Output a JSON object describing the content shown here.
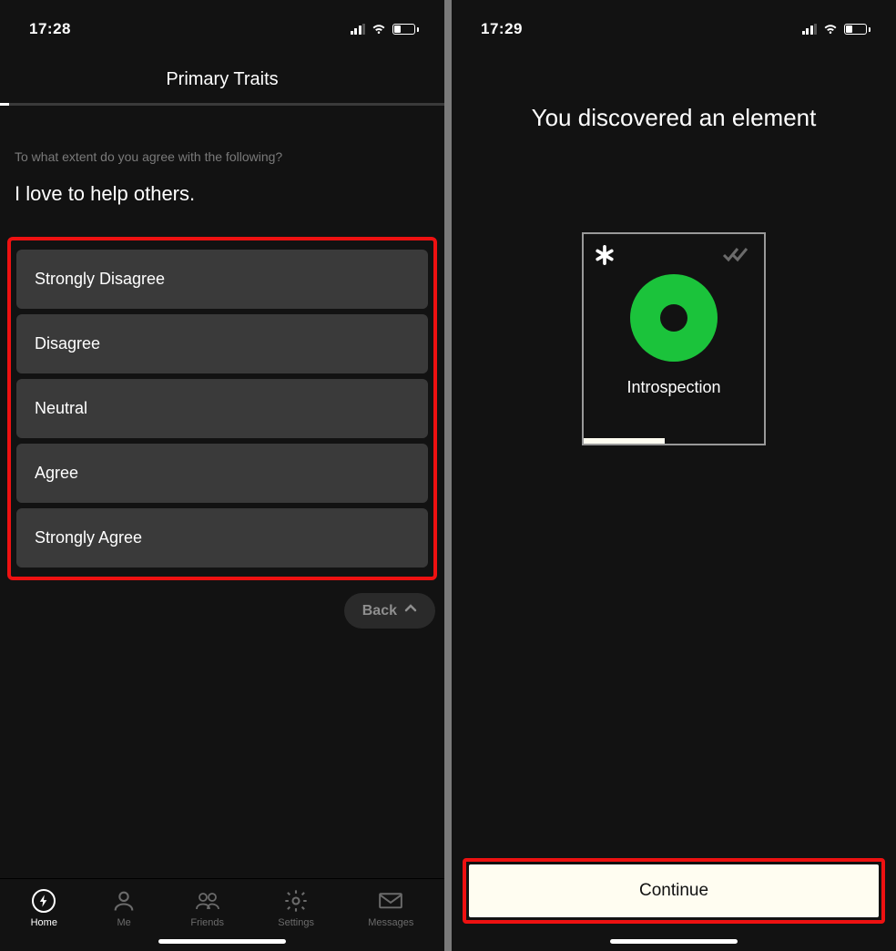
{
  "screen1": {
    "status": {
      "time": "17:28"
    },
    "title": "Primary Traits",
    "prompt_meta": "To what extent do you agree with the following?",
    "prompt_text": "I love to help others.",
    "options": [
      "Strongly Disagree",
      "Disagree",
      "Neutral",
      "Agree",
      "Strongly Agree"
    ],
    "back_label": "Back",
    "tabs": {
      "home": "Home",
      "me": "Me",
      "friends": "Friends",
      "settings": "Settings",
      "messages": "Messages"
    }
  },
  "screen2": {
    "status": {
      "time": "17:29"
    },
    "headline": "You discovered an element",
    "element_name": "Introspection",
    "continue_label": "Continue"
  },
  "colors": {
    "accent_green": "#1bc33b",
    "highlight_red": "#e11",
    "cream": "#fffdf1"
  }
}
